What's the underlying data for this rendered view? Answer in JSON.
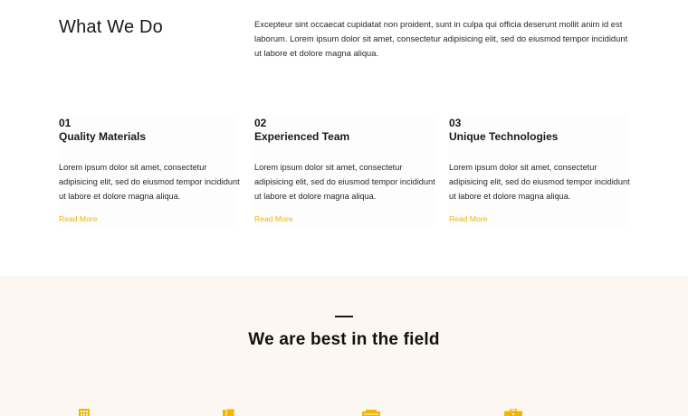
{
  "what_we_do": {
    "title": "What We Do",
    "intro": "Excepteur sint occaecat cupidatat non proident, sunt in culpa qui officia deserunt mollit anim id est laborum. Lorem ipsum dolor sit amet, consectetur adipisicing elit, sed do eiusmod tempor incididunt ut labore et dolore magna aliqua."
  },
  "cards": [
    {
      "number": "01",
      "title": "Quality Materials",
      "body": "Lorem ipsum dolor sit amet, consectetur adipisicing elit, sed do eiusmod tempor incididunt ut labore et dolore magna aliqua.",
      "link": "Read More"
    },
    {
      "number": "02",
      "title": "Experienced Team",
      "body": "Lorem ipsum dolor sit amet, consectetur adipisicing elit, sed do eiusmod tempor incididunt ut labore et dolore magna aliqua.",
      "link": "Read More"
    },
    {
      "number": "03",
      "title": "Unique Technologies",
      "body": "Lorem ipsum dolor sit amet, consectetur adipisicing elit, sed do eiusmod tempor incididunt ut labore et dolore magna aliqua.",
      "link": "Read More"
    }
  ],
  "best_section": {
    "heading": "We are best in the field",
    "icons": [
      "building-icon",
      "documents-icon",
      "truck-icon",
      "briefcase-icon"
    ]
  },
  "colors": {
    "accent": "#f2b500",
    "section_bg": "#fcf8f1",
    "text": "#1a1a1a"
  }
}
